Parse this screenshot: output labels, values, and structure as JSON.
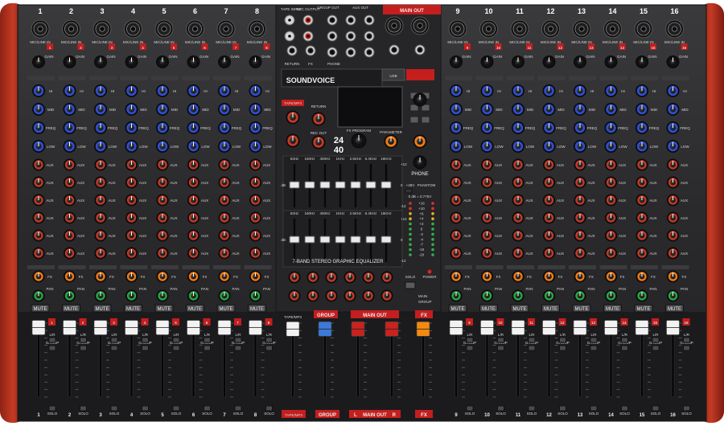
{
  "channels": [
    "1",
    "2",
    "3",
    "4",
    "5",
    "6",
    "7",
    "8",
    "9",
    "10",
    "11",
    "12",
    "13",
    "14",
    "15",
    "16"
  ],
  "strip_labels": {
    "mic_line": "MIC/LINE IN",
    "gain": "GAIN",
    "eq_hi": "HI",
    "eq_mid": "MID",
    "eq_freq": "FREQ",
    "eq_low": "LOW",
    "aux": "AUX",
    "fx": "FX",
    "pan": "PAN",
    "mute": "MUTE",
    "solo": "SOLO",
    "group": "GROUP",
    "lr": "L/R"
  },
  "master": {
    "tape_input": "TAPE INPUT",
    "rec_output": "REC OUTPUT",
    "group_out": "GROUP OUT",
    "aux_out": "AUX OUT",
    "main_out": "MAIN OUT",
    "return": "RETURN",
    "fx_jack": "FX",
    "phone": "PHONE",
    "brand": "SOUNDVOICE",
    "usb": "USB",
    "tape_mp3": "TAPE/MP3",
    "return_knob": "RETURN",
    "rec_out_knob": "REC OUT",
    "fx_program": "FX PROGRAM",
    "parameter": "PARAMETER",
    "dsp_big": "24",
    "dsp_big2": "40",
    "phone_knob": "PHONE",
    "phantom_48v": "+48V",
    "phantom": "PHANTOM",
    "eq_title": "7-BAND STEREO GRAPHIC EQUALIZER",
    "eq_bands": [
      "63Hz",
      "160Hz",
      "400Hz",
      "1KHz",
      "2.5KHz",
      "6.4KHz",
      "16KHz"
    ],
    "eq_scale_top": "+12",
    "eq_scale_mid": "0",
    "eq_scale_bot": "-12",
    "eq_unit": "dB",
    "meter_header": "0 dB = 0.775V",
    "meter_levels": [
      "+16",
      "+10",
      "+6",
      "+4",
      "+2",
      "0",
      "-2",
      "-4",
      "-7",
      "-10",
      "-20"
    ],
    "solo_btn": "SOLO",
    "power_btn": "POWER",
    "main_btn": "MAIN",
    "group_btn": "GROUP",
    "fader_tape": "TAPE/MP3",
    "fader_group": "GROUP",
    "fader_main": "MAIN OUT",
    "fader_fx": "FX",
    "fader_l": "L",
    "fader_r": "R"
  },
  "colors": {
    "side_panel": "#b8321f",
    "face": "#2b2b2d",
    "knob_blue": "#2f4fd0",
    "knob_red": "#c23a26",
    "knob_orange": "#f07a12",
    "knob_green": "#26a843",
    "fader_white": "#f2f2f2",
    "fader_blue": "#3c7ad8",
    "fader_red": "#c8231e",
    "fader_orange": "#f28a10",
    "label_red": "#c41e1e"
  }
}
